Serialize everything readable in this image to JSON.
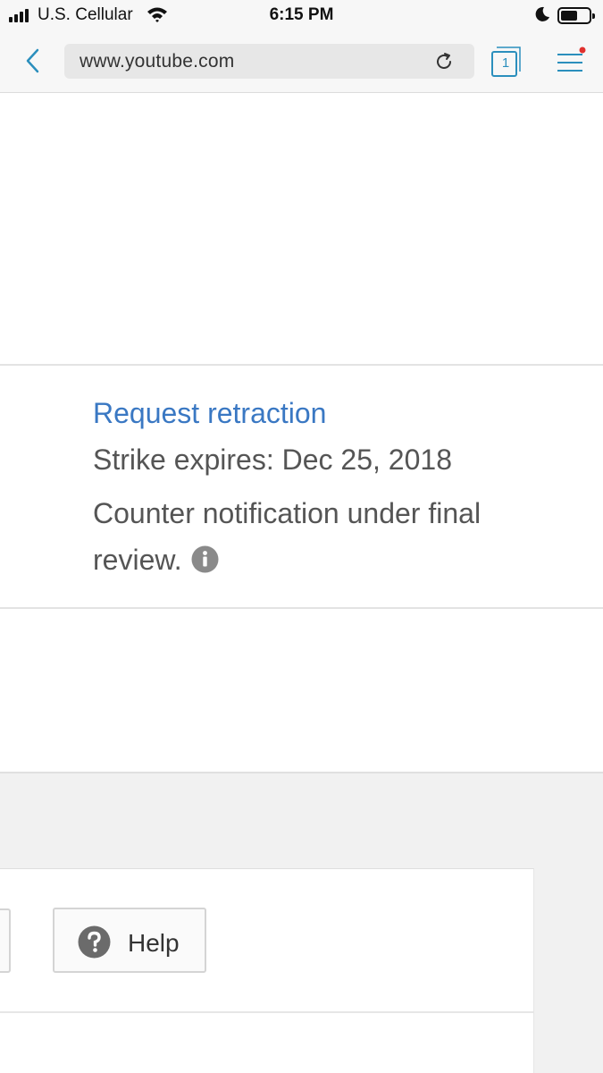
{
  "status_bar": {
    "carrier": "U.S. Cellular",
    "time": "6:15 PM"
  },
  "browser": {
    "url": "www.youtube.com",
    "tab_count": "1",
    "menu_badge_color": "#e0312e",
    "accent_color": "#2b8fbd"
  },
  "strike": {
    "action_link": "Request retraction",
    "expires": "Strike expires: Dec 25, 2018",
    "status": "Counter notification under final review."
  },
  "footer": {
    "help_label": "Help"
  },
  "icons": {
    "back": "chevron-left-icon",
    "reload": "reload-icon",
    "tabs": "tabs-icon",
    "menu": "hamburger-menu-icon",
    "info": "info-icon",
    "help": "question-circle-icon"
  }
}
